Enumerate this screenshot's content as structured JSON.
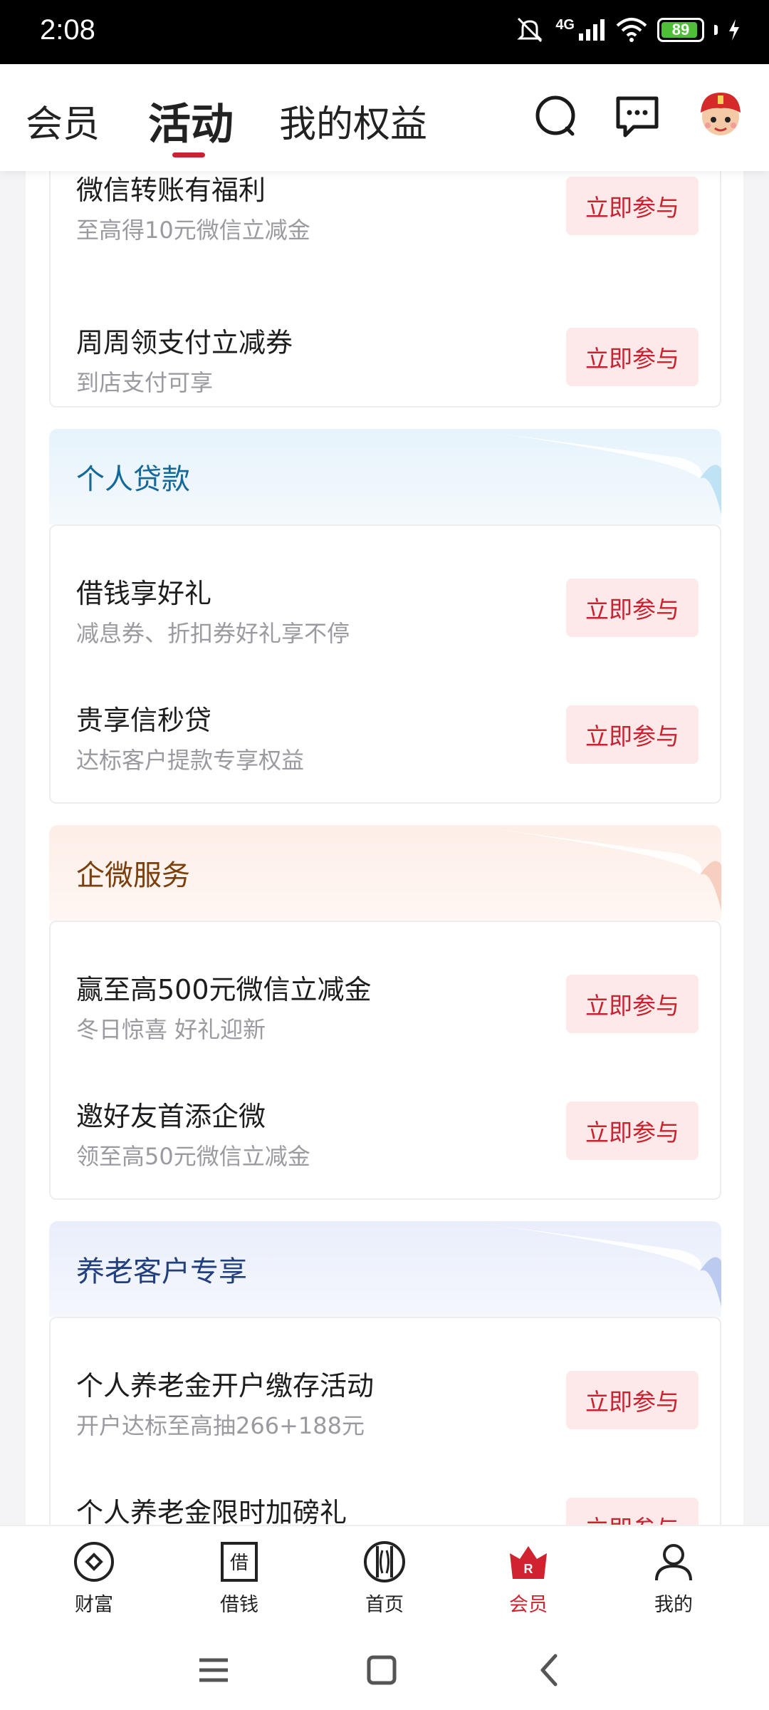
{
  "status": {
    "time": "2:08",
    "network": "4G",
    "battery": "89"
  },
  "header": {
    "tabs": [
      "会员",
      "活动",
      "我的权益"
    ],
    "active_tab": "活动"
  },
  "top_card": {
    "items": [
      {
        "title": "微信转账有福利",
        "subtitle": "至高得10元微信立减金",
        "button": "立即参与"
      },
      {
        "title": "周周领支付立减券",
        "subtitle": "到店支付可享",
        "button": "立即参与"
      }
    ]
  },
  "sections": [
    {
      "title": "个人贷款",
      "title_color": "#14699a",
      "items": [
        {
          "title": "借钱享好礼",
          "subtitle": "减息券、折扣券好礼享不停",
          "button": "立即参与"
        },
        {
          "title": "贵享信秒贷",
          "subtitle": "达标客户提款专享权益",
          "button": "立即参与"
        }
      ]
    },
    {
      "title": "企微服务",
      "title_color": "#7a3f0c",
      "items": [
        {
          "title": "赢至高500元微信立减金",
          "subtitle": "冬日惊喜 好礼迎新",
          "button": "立即参与"
        },
        {
          "title": "邀好友首添企微",
          "subtitle": "领至高50元微信立减金",
          "button": "立即参与"
        }
      ]
    },
    {
      "title": "养老客户专享",
      "title_color": "#23407e",
      "items": [
        {
          "title": "个人养老金开户缴存活动",
          "subtitle": "开户达标至高抽266+188元",
          "button": "立即参与"
        },
        {
          "title": "个人养老金限时加磅礼",
          "subtitle": "",
          "button": "立即参与"
        }
      ]
    }
  ],
  "bottom_nav": [
    {
      "label": "财富",
      "icon": "wealth-icon"
    },
    {
      "label": "借钱",
      "icon": "borrow-icon"
    },
    {
      "label": "首页",
      "icon": "home-icon"
    },
    {
      "label": "会员",
      "icon": "member-crown-icon",
      "active": true
    },
    {
      "label": "我的",
      "icon": "profile-icon"
    }
  ],
  "colors": {
    "accent": "#c8232e",
    "button_bg": "#fde8ea"
  }
}
